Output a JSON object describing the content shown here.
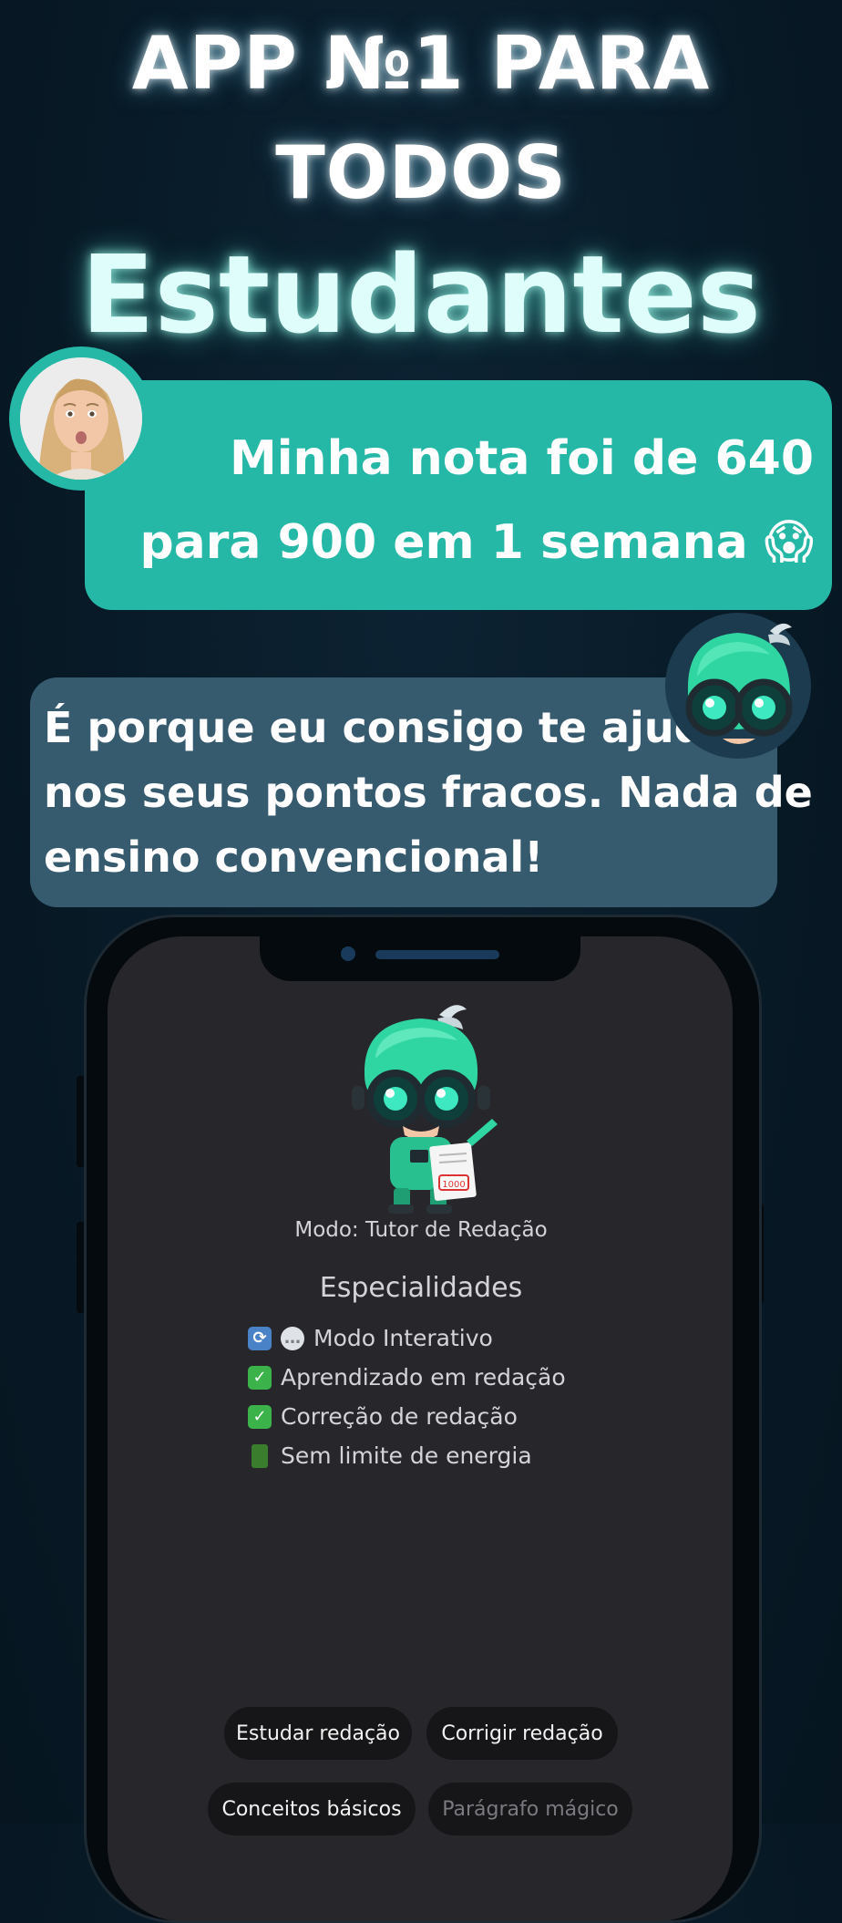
{
  "headline": {
    "line1": "APP №1 PARA",
    "line2": "TODOS",
    "line3": "Estudantes"
  },
  "user_message": {
    "line1": "Minha nota foi de 640",
    "line2": "para 900 em 1 semana 😱"
  },
  "bot_message": {
    "line1": "É porque eu consigo te ajudar",
    "line2": "nos seus pontos fracos. Nada de",
    "line3": "ensino convencional!"
  },
  "phone": {
    "mode_label": "Modo: Tutor de Redação",
    "paper_score": "1000",
    "specialties_title": "Especialidades",
    "specialties": [
      {
        "icon": "sync-chat-icon",
        "label": "Modo Interativo"
      },
      {
        "icon": "check-icon",
        "label": "Aprendizado em redação"
      },
      {
        "icon": "check-icon",
        "label": "Correção de redação"
      },
      {
        "icon": "battery-icon",
        "label": "Sem limite de energia"
      }
    ],
    "chips": [
      {
        "label": "Estudar redação",
        "enabled": true
      },
      {
        "label": "Corrigir redação",
        "enabled": true
      },
      {
        "label": "Conceitos básicos",
        "enabled": true
      },
      {
        "label": "Parágrafo mágico",
        "enabled": false
      }
    ]
  },
  "colors": {
    "background": "#081a27",
    "user_bubble": "#26b8a7",
    "bot_bubble": "#365a6e",
    "screen": "#26262b",
    "chip": "#161618"
  }
}
